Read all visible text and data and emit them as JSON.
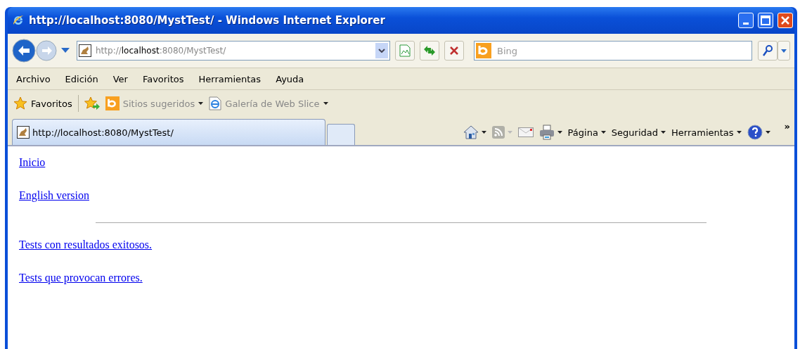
{
  "window": {
    "title": "http://localhost:8080/MystTest/ - Windows Internet Explorer"
  },
  "address_bar": {
    "url_parts": [
      {
        "text": "http://",
        "emphasis": false
      },
      {
        "text": "localhost",
        "emphasis": true
      },
      {
        "text": ":8080/MystTest/",
        "emphasis": false
      }
    ]
  },
  "search": {
    "placeholder": "Bing"
  },
  "menu": [
    "Archivo",
    "Edición",
    "Ver",
    "Favoritos",
    "Herramientas",
    "Ayuda"
  ],
  "favorites_bar": {
    "label": "Favoritos",
    "items": [
      {
        "label": "Sitios sugeridos",
        "kind": "bing"
      },
      {
        "label": "Galería de Web Slice",
        "kind": "ie"
      }
    ]
  },
  "tabs": [
    {
      "label": "http://localhost:8080/MystTest/",
      "selected": true
    }
  ],
  "command_bar": {
    "feeds_disabled": true,
    "menus": [
      "Página",
      "Seguridad",
      "Herramientas"
    ],
    "overflow": "»"
  },
  "page": {
    "links_top": [
      "Inicio",
      "English version"
    ],
    "links_bottom": [
      "Tests con resultados exitosos.",
      "Tests que provocan errores."
    ]
  }
}
